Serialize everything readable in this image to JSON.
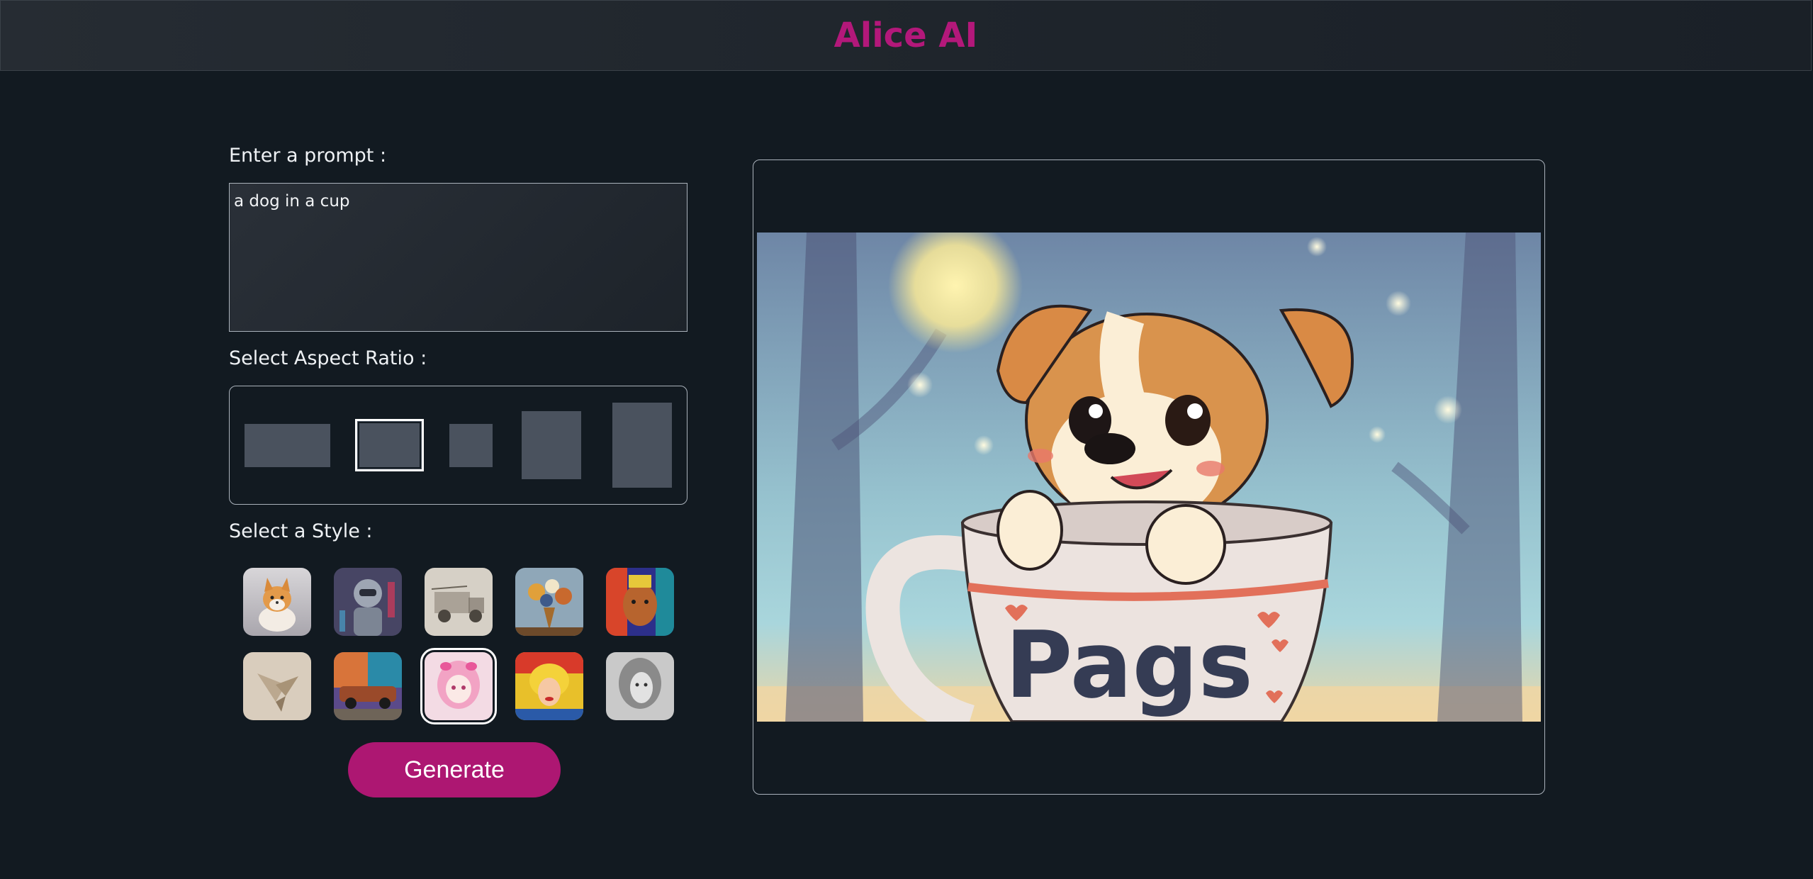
{
  "app": {
    "title": "Alice AI"
  },
  "prompt": {
    "label": "Enter a prompt :",
    "value": "a dog in a cup"
  },
  "aspect_ratio": {
    "label": "Select Aspect Ratio :",
    "options": [
      "wide",
      "landscape",
      "square",
      "portrait",
      "tall"
    ],
    "selected": "landscape"
  },
  "style": {
    "label": "Select a Style :",
    "options": [
      "3d-dog",
      "cyberpunk-robot",
      "sketch-truck",
      "oil-flowers",
      "colorful-face",
      "origami-bird",
      "graffiti-car",
      "anime-girl",
      "pop-art",
      "pencil-portrait"
    ],
    "selected": "anime-girl"
  },
  "generate": {
    "label": "Generate"
  },
  "preview": {
    "cup_text": "Pags"
  },
  "colors": {
    "accent": "#ad1772",
    "background": "#121a21",
    "brand": "#b3187a"
  }
}
